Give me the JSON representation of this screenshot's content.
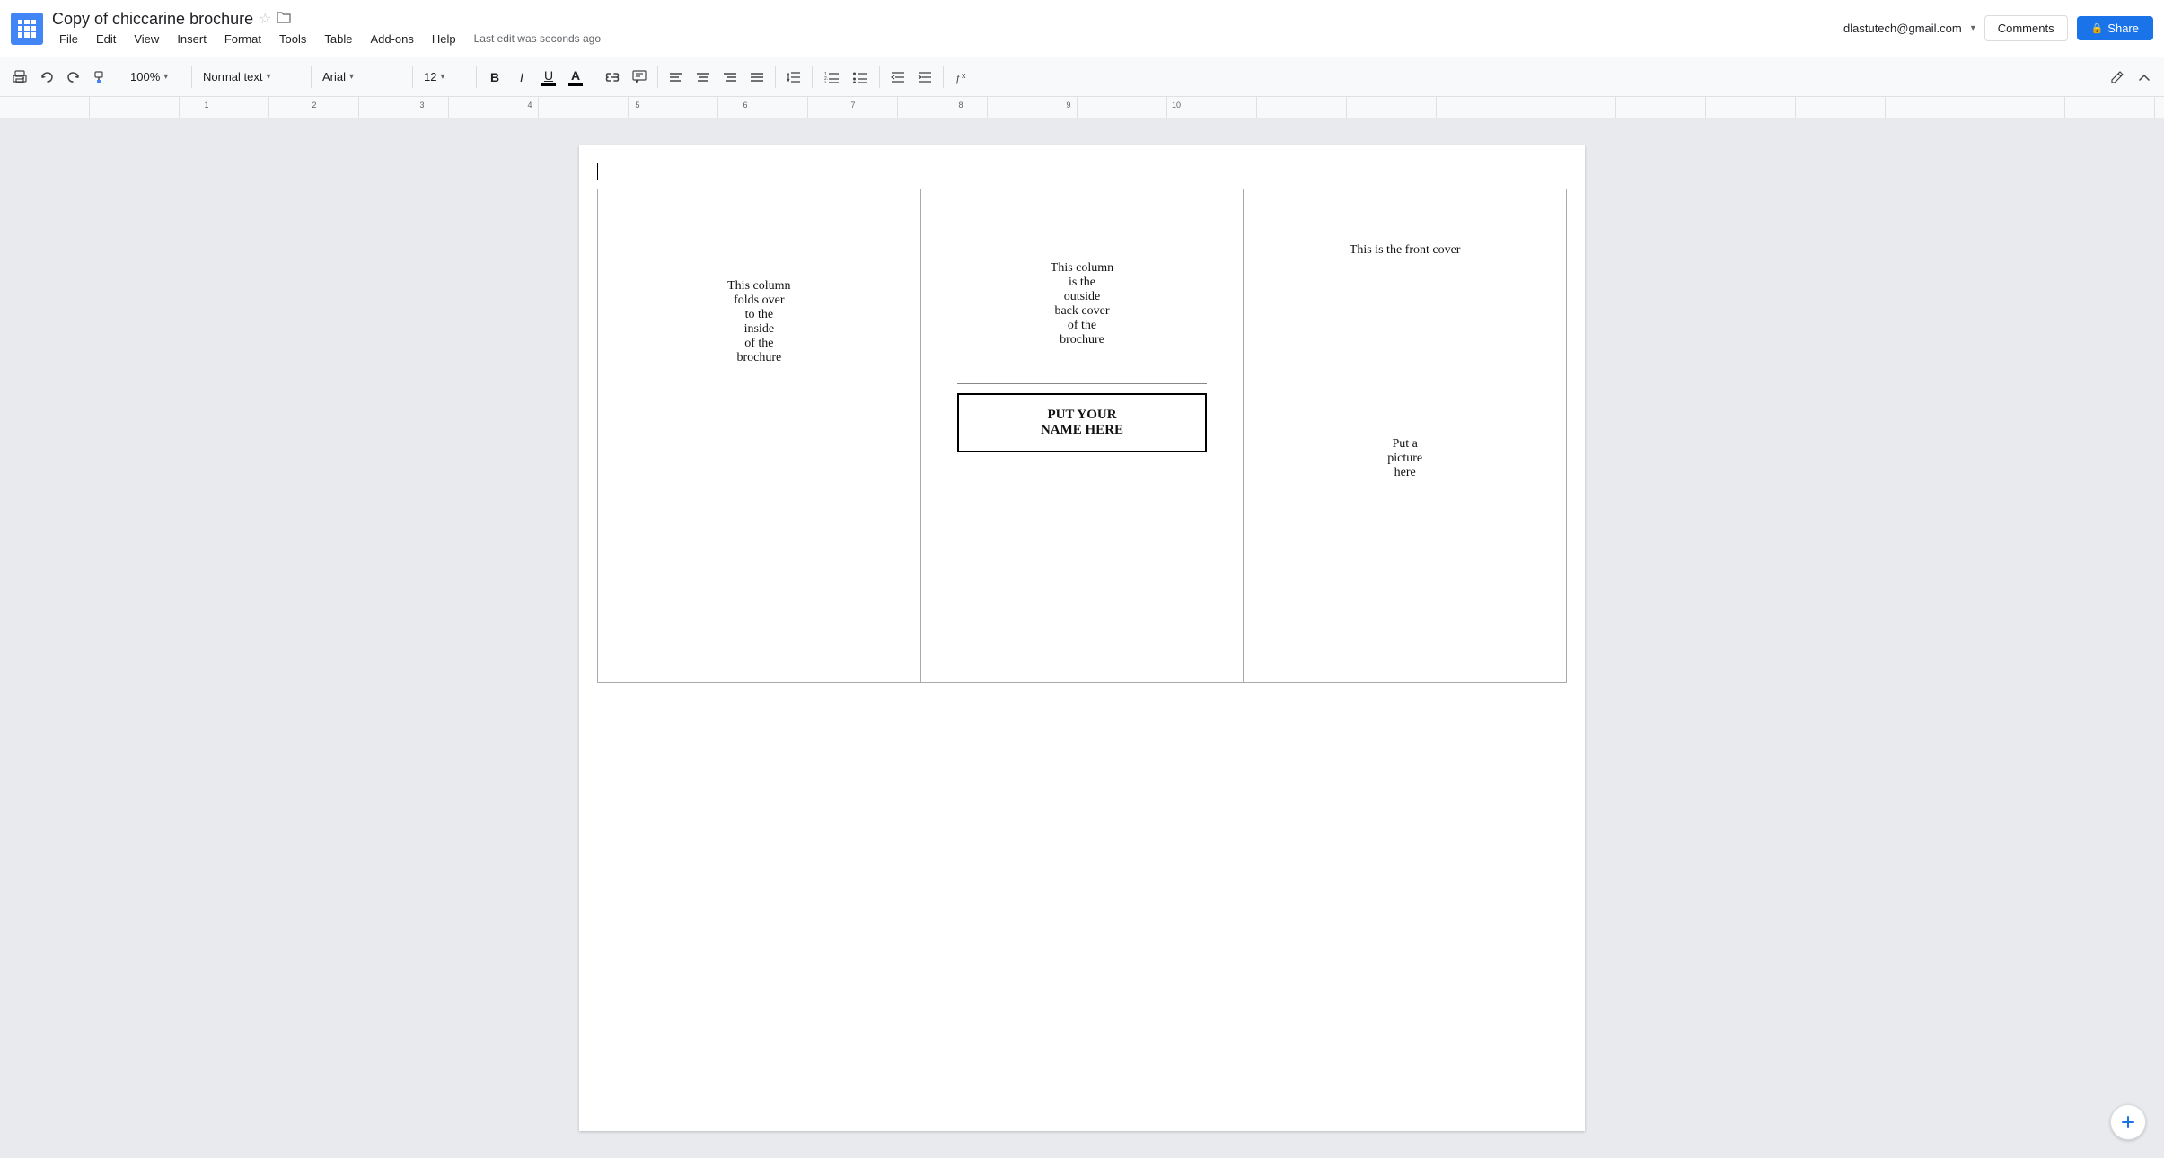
{
  "app": {
    "icon_label": "Google Docs",
    "title": "Copy of chiccarine brochure",
    "star_icon": "☆",
    "folder_icon": "▣"
  },
  "menu": {
    "items": [
      "File",
      "Edit",
      "View",
      "Insert",
      "Format",
      "Tools",
      "Table",
      "Add-ons",
      "Help"
    ],
    "last_edit": "Last edit was seconds ago"
  },
  "toolbar": {
    "print_icon": "🖨",
    "undo_icon": "↩",
    "redo_icon": "↪",
    "paint_format_icon": "⬛",
    "zoom": "100%",
    "zoom_arrow": "▾",
    "style": "Normal text",
    "style_arrow": "▾",
    "font": "Arial",
    "font_arrow": "▾",
    "size": "12",
    "size_arrow": "▾",
    "bold": "B",
    "italic": "I",
    "underline": "U",
    "align_left": "≡",
    "align_center": "≡",
    "align_right": "≡",
    "align_justify": "≡",
    "line_spacing": "↕",
    "ordered_list": "1.",
    "bullet_list": "•",
    "indent_less": "⇤",
    "indent_more": "⇥",
    "formula": "fx",
    "pen_icon": "✏",
    "collapse_icon": "⌃"
  },
  "ruler": {
    "numbers": [
      "1",
      "2",
      "3",
      "4",
      "5",
      "6",
      "7",
      "8",
      "9",
      "10"
    ]
  },
  "user": {
    "email": "dlastutech@gmail.com",
    "dropdown": "▾"
  },
  "header_buttons": {
    "comments": "Comments",
    "share": "Share",
    "lock_icon": "🔒"
  },
  "document": {
    "col1_text": "This column\nfolds over\nto the\ninside\nof the\nbrochure",
    "col2_top_text": "This column\nis the\noutside\nback cover\nof the\nbrochure",
    "name_box_text": "PUT YOUR\nNAME HERE",
    "col3_top_text": "This is the front cover",
    "col3_picture_text": "Put a\npicture\nhere"
  }
}
